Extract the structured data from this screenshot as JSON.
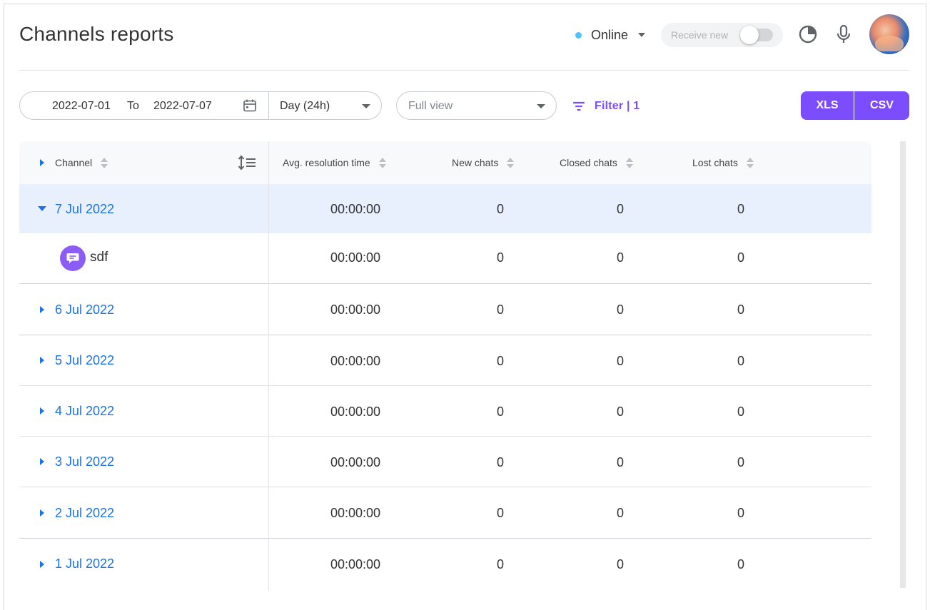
{
  "header": {
    "title": "Channels reports",
    "status": {
      "label": "Online",
      "dot_color": "#4fc3f7"
    },
    "receive_toggle": {
      "label": "Receive new",
      "on": false
    },
    "icons": [
      "pie-chart-icon",
      "microphone-icon",
      "avatar"
    ]
  },
  "toolbar": {
    "date_from": "2022-07-01",
    "date_separator": "To",
    "date_to": "2022-07-07",
    "period": "Day (24h)",
    "view_placeholder": "Full view",
    "filter_label": "Filter | 1",
    "export_xls": "XLS",
    "export_csv": "CSV",
    "accent_color": "#7c4dff"
  },
  "table": {
    "columns": {
      "channel": "Channel",
      "avg": "Avg. resolution time",
      "new": "New chats",
      "closed": "Closed chats",
      "lost": "Lost chats"
    },
    "rows": [
      {
        "date": "7 Jul 2022",
        "avg": "00:00:00",
        "new": "0",
        "closed": "0",
        "lost": "0",
        "expanded": true
      },
      {
        "channel": "sdf",
        "avg": "00:00:00",
        "new": "0",
        "closed": "0",
        "lost": "0"
      },
      {
        "date": "6 Jul 2022",
        "avg": "00:00:00",
        "new": "0",
        "closed": "0",
        "lost": "0"
      },
      {
        "date": "5 Jul 2022",
        "avg": "00:00:00",
        "new": "0",
        "closed": "0",
        "lost": "0"
      },
      {
        "date": "4 Jul 2022",
        "avg": "00:00:00",
        "new": "0",
        "closed": "0",
        "lost": "0"
      },
      {
        "date": "3 Jul 2022",
        "avg": "00:00:00",
        "new": "0",
        "closed": "0",
        "lost": "0"
      },
      {
        "date": "2 Jul 2022",
        "avg": "00:00:00",
        "new": "0",
        "closed": "0",
        "lost": "0"
      },
      {
        "date": "1 Jul 2022",
        "avg": "00:00:00",
        "new": "0",
        "closed": "0",
        "lost": "0"
      }
    ]
  }
}
